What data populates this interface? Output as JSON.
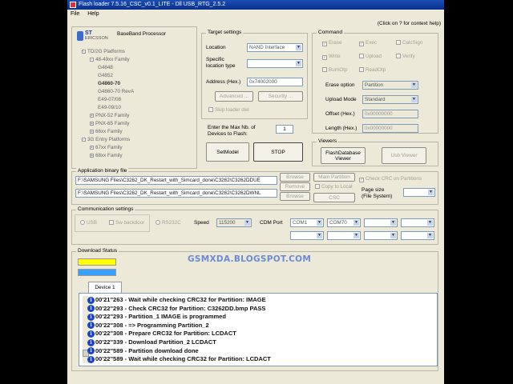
{
  "window": {
    "title": "Flash loader 7.5.16_CSC_v0.1_LITE - Dll USB_RTG_2.5.2"
  },
  "menu": {
    "file": "File",
    "help": "Help"
  },
  "help_hint": "(Click on ? for context help)",
  "baseband": {
    "title": "BaseBand Processor",
    "logo_line1": "ST",
    "logo_line2": "ERICSSON",
    "tree": [
      {
        "label": "TD/2G Platforms",
        "level": 0,
        "exp": "-"
      },
      {
        "label": "48-49xx Family",
        "level": 1,
        "exp": "-"
      },
      {
        "label": "G4848",
        "level": 2,
        "exp": ""
      },
      {
        "label": "G4852",
        "level": 2,
        "exp": ""
      },
      {
        "label": "G4860-70",
        "level": 2,
        "exp": "",
        "bold": true
      },
      {
        "label": "G4860-70 RevA",
        "level": 2,
        "exp": ""
      },
      {
        "label": "E49-07/08",
        "level": 2,
        "exp": ""
      },
      {
        "label": "E49-09/10",
        "level": 2,
        "exp": ""
      },
      {
        "label": "PNX-52 Family",
        "level": 1,
        "exp": "+"
      },
      {
        "label": "PNX-65 Family",
        "level": 1,
        "exp": "+"
      },
      {
        "label": "66xx Family",
        "level": 1,
        "exp": "+"
      },
      {
        "label": "3G Entry Platforms",
        "level": 0,
        "exp": "-"
      },
      {
        "label": "67xx Family",
        "level": 1,
        "exp": "+"
      },
      {
        "label": "68xx Family",
        "level": 1,
        "exp": "+"
      }
    ]
  },
  "target": {
    "title": "Target settings",
    "location_label": "Location",
    "location_value": "NAND Interface",
    "specific_label_1": "Specific",
    "specific_label_2": "location type",
    "address_label": "Address (Hex.)",
    "address_value": "0x74002000",
    "advanced": "Advanced ...",
    "security": "Security ...",
    "skip_loader": "Skip loader dwl"
  },
  "max_devices": {
    "label_1": "Enter the Max Nb. of",
    "label_2": "Devices to Flash:",
    "value": "1"
  },
  "setmodel": "SetModel",
  "stop": "STOP",
  "command": {
    "title": "Command",
    "checks": [
      "Erase",
      "Exec",
      "CalcSign",
      "Write",
      "Upload",
      "Verify",
      "BurnOtp",
      "ReadOtp"
    ],
    "erase_option_label": "Erase option",
    "erase_option_value": "Partition",
    "upload_mode_label": "Upload Mode",
    "upload_mode_value": "Standard",
    "offset_label": "Offset (Hex.)",
    "offset_value": "0x00000000",
    "length_label": "Length (Hex.)",
    "length_value": "0x00000000"
  },
  "viewers": {
    "title": "Viewers",
    "flashdb": "FlashDatabase Viewer",
    "usb": "Usb Viewer"
  },
  "binary": {
    "title": "Application binary file",
    "file1": "F:\\SAMSUNG Files\\C3262_DK_Restart_with_Simcard_done\\C3262\\C3262DDUE",
    "file2": "F:\\SAMSUNG Files\\C3262_DK_Restart_with_Simcard_done\\C3262\\C3262DWNL",
    "browse": "Browse",
    "remove": "Remove",
    "browse2": "Browse",
    "main_partition": "Main Partition",
    "copy_to_local": "Copy to Local",
    "csc": "CSC",
    "check_crc": "Check CRC on Partitions",
    "page_size_1": "Page size",
    "page_size_2": "(File System)"
  },
  "comm": {
    "title": "Communication settings",
    "usb": "USB",
    "sw_backdoor": "Sw backdoor",
    "rs232": "RS232C",
    "speed_label": "Speed",
    "speed_value": "115200",
    "cdm_label": "CDM Port",
    "com1": "COM1",
    "com70": "COM70"
  },
  "download": {
    "title": "Download Status",
    "tab": "Device 1"
  },
  "watermark": "GSMXDA.BLOGSPOT.COM",
  "log": [
    "00'21''263 - Wait while checking CRC32 for Partition: IMAGE",
    "00'22''293 - Check CRC32 for Partition: C3262DD.bmp PASS",
    "00'22''293 - Partition_1 IMAGE is programmed",
    "00'22''308 -  => Programming Partition_2",
    "00'22''308 - Prepare CRC32 for Partition: LCDACT",
    "00'22''339 - Download Partition_2 LCDACT",
    "00'22''589 - Partition download done",
    "00'22''589 - Wait while checking CRC32 for Partition: LCDACT"
  ],
  "colors": {
    "title_bg": "#0a2f8a",
    "progress1": "#ffff00",
    "progress2": "#3aa0ff",
    "info_icon": "#1a45c8"
  }
}
